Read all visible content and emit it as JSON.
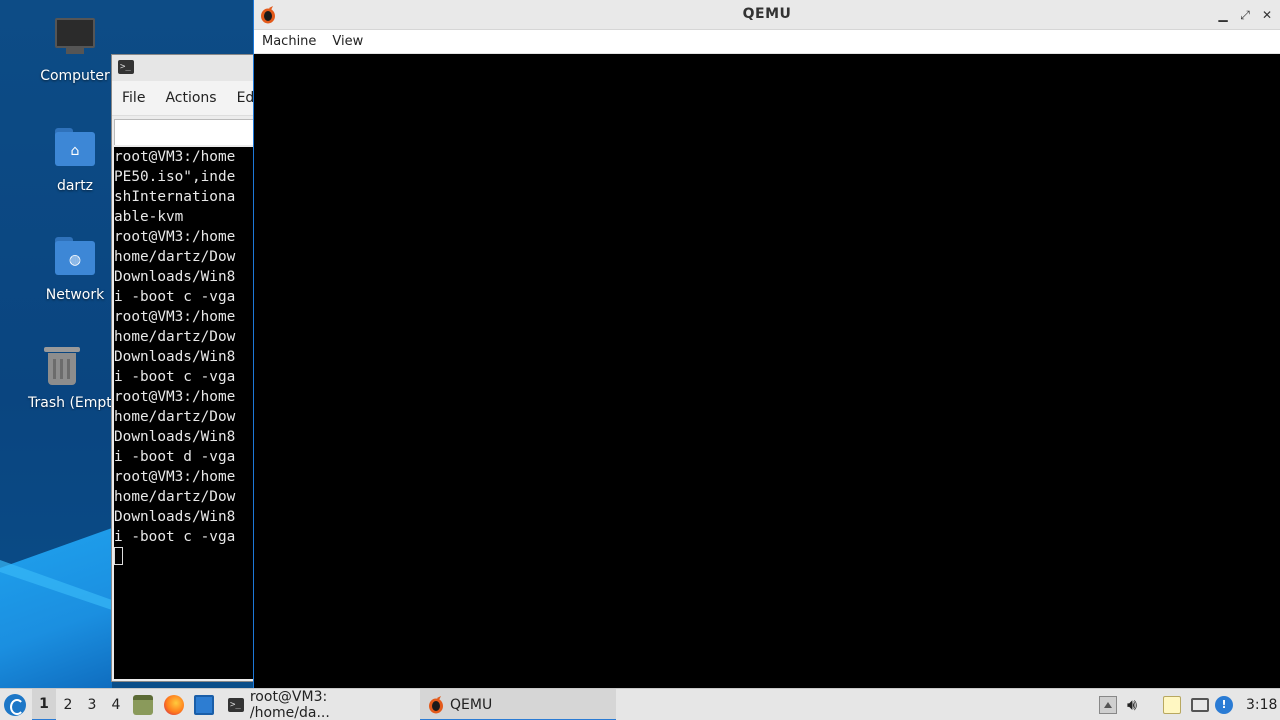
{
  "desktop": {
    "icons": [
      {
        "label": "Computer",
        "icon": "computer-icon"
      },
      {
        "label": "dartz",
        "icon": "home-folder-icon"
      },
      {
        "label": "Network",
        "icon": "network-folder-icon"
      },
      {
        "label": "Trash (Empty)",
        "icon": "trash-icon"
      }
    ]
  },
  "terminal": {
    "menu": [
      "File",
      "Actions",
      "Ed"
    ],
    "lines": [
      "root@VM3:/home",
      "PE50.iso\",inde",
      "shInternationa",
      "able-kvm",
      "root@VM3:/home",
      "home/dartz/Dow",
      "Downloads/Win8",
      "i -boot c -vga",
      "root@VM3:/home",
      "home/dartz/Dow",
      "Downloads/Win8",
      "i -boot c -vga",
      "root@VM3:/home",
      "home/dartz/Dow",
      "Downloads/Win8",
      "i -boot d -vga",
      "root@VM3:/home",
      "home/dartz/Dow",
      "Downloads/Win8",
      "i -boot c -vga"
    ]
  },
  "qemu": {
    "title": "QEMU",
    "menu": [
      "Machine",
      "View"
    ],
    "window_buttons": [
      "minimize-icon",
      "maximize-icon",
      "close-icon"
    ]
  },
  "taskbar": {
    "desktops": [
      "1",
      "2",
      "3",
      "4"
    ],
    "active_desktop": "1",
    "tasks": [
      {
        "label": "root@VM3: /home/da...",
        "icon": "terminal-icon"
      },
      {
        "label": "QEMU",
        "icon": "qemu-icon"
      }
    ],
    "clock": "3:18"
  },
  "colors": {
    "accent": "#2a7bd4",
    "desktop_bg": "#0d4c86",
    "folder": "#3d87d6"
  }
}
